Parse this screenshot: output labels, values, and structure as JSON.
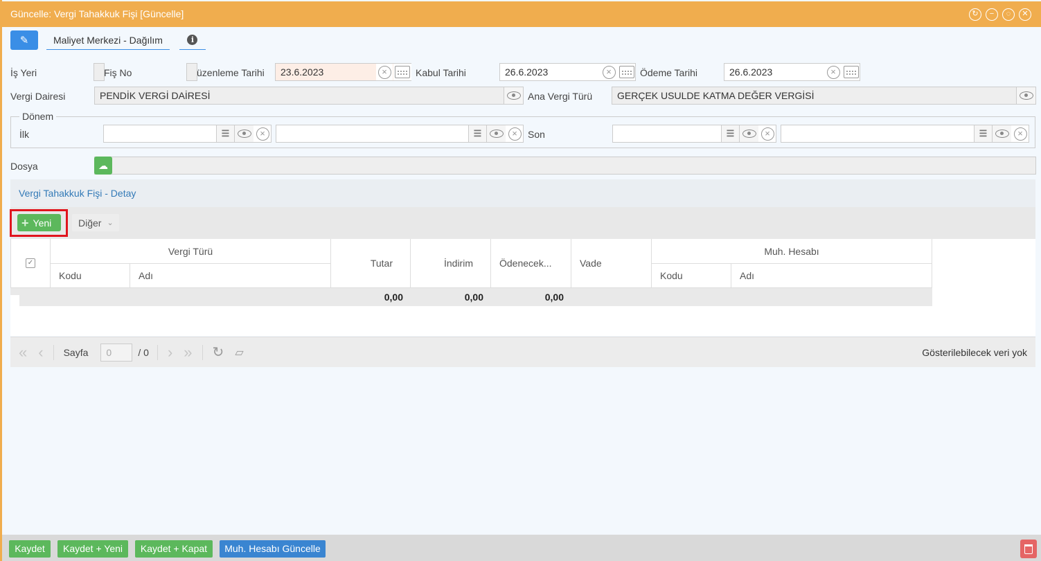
{
  "window": {
    "title": "Güncelle: Vergi Tahakkuk Fişi [Güncelle]"
  },
  "tabs": {
    "main": "Maliyet Merkezi - Dağılım"
  },
  "form": {
    "is_yeri_label": "İş Yeri",
    "fis_no_label": "Fiş No",
    "duzenleme_label": "üzenleme Tarihi",
    "duzenleme_value": "23.6.2023",
    "kabul_label": "Kabul Tarihi",
    "kabul_value": "26.6.2023",
    "odeme_label": "Ödeme Tarihi",
    "odeme_value": "26.6.2023",
    "vergi_dairesi_label": "Vergi Dairesi",
    "vergi_dairesi_value": "PENDİK VERGİ DAİRESİ",
    "ana_vergi_label": "Ana Vergi Türü",
    "ana_vergi_value": "GERÇEK USULDE KATMA DEĞER VERGİSİ",
    "donem_legend": "Dönem",
    "ilk_label": "İlk",
    "son_label": "Son",
    "dosya_label": "Dosya"
  },
  "detail": {
    "title": "Vergi Tahakkuk Fişi - Detay",
    "yeni_label": "Yeni",
    "diger_label": "Diğer"
  },
  "grid": {
    "vergi_turu": "Vergi Türü",
    "kodu": "Kodu",
    "adi": "Adı",
    "tutar": "Tutar",
    "indirim": "İndirim",
    "odenecek": "Ödenecek...",
    "vade": "Vade",
    "muh_hesabi": "Muh. Hesabı",
    "muh_kodu": "Kodu",
    "muh_adi": "Adı",
    "sum_tutar": "0,00",
    "sum_indirim": "0,00",
    "sum_odenecek": "0,00"
  },
  "pager": {
    "sayfa_label": "Sayfa",
    "page_value": "0",
    "total": "/ 0",
    "status": "Gösterilebilecek veri yok"
  },
  "footer": {
    "kaydet": "Kaydet",
    "kaydet_yeni": "Kaydet + Yeni",
    "kaydet_kapat": "Kaydet + Kapat",
    "muh_guncelle": "Muh. Hesabı Güncelle"
  }
}
